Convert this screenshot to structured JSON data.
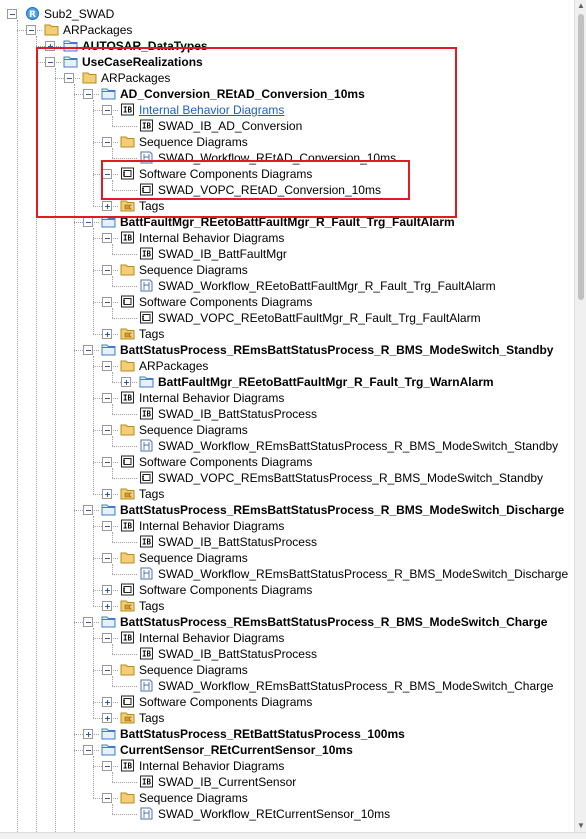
{
  "tree": {
    "nodes": [
      {
        "label": "Sub2_SWAD",
        "icon": "project-icon",
        "level": 0,
        "expander": "minus"
      },
      {
        "label": "ARPackages",
        "icon": "folder-icon",
        "level": 1,
        "expander": "minus"
      },
      {
        "label": "AUTOSAR_DataTypes",
        "icon": "package-icon",
        "level": 2,
        "expander": "plus",
        "bold": true
      },
      {
        "label": "UseCaseRealizations",
        "icon": "package-icon",
        "level": 2,
        "expander": "minus",
        "bold": true
      },
      {
        "label": "ARPackages",
        "icon": "folder-icon",
        "level": 3,
        "expander": "minus"
      },
      {
        "label": "AD_Conversion_REtAD_Conversion_10ms",
        "icon": "package-icon",
        "level": 4,
        "expander": "minus",
        "bold": true
      },
      {
        "label": "Internal Behavior Diagrams",
        "icon": "ib-folder-icon",
        "level": 5,
        "expander": "minus",
        "link": true
      },
      {
        "label": "SWAD_IB_AD_Conversion",
        "icon": "ib-diagram-icon",
        "level": 6
      },
      {
        "label": "Sequence Diagrams",
        "icon": "folder-icon",
        "level": 5,
        "expander": "minus"
      },
      {
        "label": "SWAD_Workflow_REtAD_Conversion_10ms",
        "icon": "sequence-diagram-icon",
        "level": 6
      },
      {
        "label": "Software Components Diagrams",
        "icon": "component-folder-icon",
        "level": 5,
        "expander": "minus"
      },
      {
        "label": "SWAD_VOPC_REtAD_Conversion_10ms",
        "icon": "component-diagram-icon",
        "level": 6
      },
      {
        "label": "Tags",
        "icon": "tags-folder-icon",
        "level": 5,
        "expander": "plus"
      },
      {
        "label": "BattFaultMgr_REetoBattFaultMgr_R_Fault_Trg_FaultAlarm",
        "icon": "package-icon",
        "level": 4,
        "expander": "minus",
        "bold": true
      },
      {
        "label": "Internal Behavior Diagrams",
        "icon": "ib-folder-icon",
        "level": 5,
        "expander": "minus"
      },
      {
        "label": "SWAD_IB_BattFaultMgr",
        "icon": "ib-diagram-icon",
        "level": 6
      },
      {
        "label": "Sequence Diagrams",
        "icon": "folder-icon",
        "level": 5,
        "expander": "minus"
      },
      {
        "label": "SWAD_Workflow_REetoBattFaultMgr_R_Fault_Trg_FaultAlarm",
        "icon": "sequence-diagram-icon",
        "level": 6
      },
      {
        "label": "Software Components Diagrams",
        "icon": "component-folder-icon",
        "level": 5,
        "expander": "minus"
      },
      {
        "label": "SWAD_VOPC_REetoBattFaultMgr_R_Fault_Trg_FaultAlarm",
        "icon": "component-diagram-icon",
        "level": 6
      },
      {
        "label": "Tags",
        "icon": "tags-folder-icon",
        "level": 5,
        "expander": "plus"
      },
      {
        "label": "BattStatusProcess_REmsBattStatusProcess_R_BMS_ModeSwitch_Standby",
        "icon": "package-icon",
        "level": 4,
        "expander": "minus",
        "bold": true
      },
      {
        "label": "ARPackages",
        "icon": "folder-icon",
        "level": 5,
        "expander": "minus"
      },
      {
        "label": "BattFaultMgr_REetoBattFaultMgr_R_Fault_Trg_WarnAlarm",
        "icon": "package-icon",
        "level": 6,
        "expander": "plus",
        "bold": true
      },
      {
        "label": "Internal Behavior Diagrams",
        "icon": "ib-folder-icon",
        "level": 5,
        "expander": "minus"
      },
      {
        "label": "SWAD_IB_BattStatusProcess",
        "icon": "ib-diagram-icon",
        "level": 6
      },
      {
        "label": "Sequence Diagrams",
        "icon": "folder-icon",
        "level": 5,
        "expander": "minus"
      },
      {
        "label": "SWAD_Workflow_REmsBattStatusProcess_R_BMS_ModeSwitch_Standby",
        "icon": "sequence-diagram-icon",
        "level": 6
      },
      {
        "label": "Software Components Diagrams",
        "icon": "component-folder-icon",
        "level": 5,
        "expander": "minus"
      },
      {
        "label": "SWAD_VOPC_REmsBattStatusProcess_R_BMS_ModeSwitch_Standby",
        "icon": "component-diagram-icon",
        "level": 6
      },
      {
        "label": "Tags",
        "icon": "tags-folder-icon",
        "level": 5,
        "expander": "plus"
      },
      {
        "label": "BattStatusProcess_REmsBattStatusProcess_R_BMS_ModeSwitch_Discharge",
        "icon": "package-icon",
        "level": 4,
        "expander": "minus",
        "bold": true
      },
      {
        "label": "Internal Behavior Diagrams",
        "icon": "ib-folder-icon",
        "level": 5,
        "expander": "minus"
      },
      {
        "label": "SWAD_IB_BattStatusProcess",
        "icon": "ib-diagram-icon",
        "level": 6
      },
      {
        "label": "Sequence Diagrams",
        "icon": "folder-icon",
        "level": 5,
        "expander": "minus"
      },
      {
        "label": "SWAD_Workflow_REmsBattStatusProcess_R_BMS_ModeSwitch_Discharge",
        "icon": "sequence-diagram-icon",
        "level": 6
      },
      {
        "label": "Software Components Diagrams",
        "icon": "component-folder-icon",
        "level": 5,
        "expander": "plus"
      },
      {
        "label": "Tags",
        "icon": "tags-folder-icon",
        "level": 5,
        "expander": "plus"
      },
      {
        "label": "BattStatusProcess_REmsBattStatusProcess_R_BMS_ModeSwitch_Charge",
        "icon": "package-icon",
        "level": 4,
        "expander": "minus",
        "bold": true
      },
      {
        "label": "Internal Behavior Diagrams",
        "icon": "ib-folder-icon",
        "level": 5,
        "expander": "minus"
      },
      {
        "label": "SWAD_IB_BattStatusProcess",
        "icon": "ib-diagram-icon",
        "level": 6
      },
      {
        "label": "Sequence Diagrams",
        "icon": "folder-icon",
        "level": 5,
        "expander": "minus"
      },
      {
        "label": "SWAD_Workflow_REmsBattStatusProcess_R_BMS_ModeSwitch_Charge",
        "icon": "sequence-diagram-icon",
        "level": 6
      },
      {
        "label": "Software Components Diagrams",
        "icon": "component-folder-icon",
        "level": 5,
        "expander": "plus"
      },
      {
        "label": "Tags",
        "icon": "tags-folder-icon",
        "level": 5,
        "expander": "plus"
      },
      {
        "label": "BattStatusProcess_REtBattStatusProcess_100ms",
        "icon": "package-icon",
        "level": 4,
        "expander": "plus",
        "bold": true
      },
      {
        "label": "CurrentSensor_REtCurrentSensor_10ms",
        "icon": "package-icon",
        "level": 4,
        "expander": "minus",
        "bold": true
      },
      {
        "label": "Internal Behavior Diagrams",
        "icon": "ib-folder-icon",
        "level": 5,
        "expander": "minus"
      },
      {
        "label": "SWAD_IB_CurrentSensor",
        "icon": "ib-diagram-icon",
        "level": 6
      },
      {
        "label": "Sequence Diagrams",
        "icon": "folder-icon",
        "level": 5,
        "expander": "minus"
      },
      {
        "label": "SWAD_Workflow_REtCurrentSensor_10ms",
        "icon": "sequence-diagram-icon",
        "level": 6
      }
    ]
  },
  "colors": {
    "highlight": "#e01b24",
    "folder": "#f2cf72",
    "package": "#3d7bd0",
    "link": "#1d5fbf"
  }
}
